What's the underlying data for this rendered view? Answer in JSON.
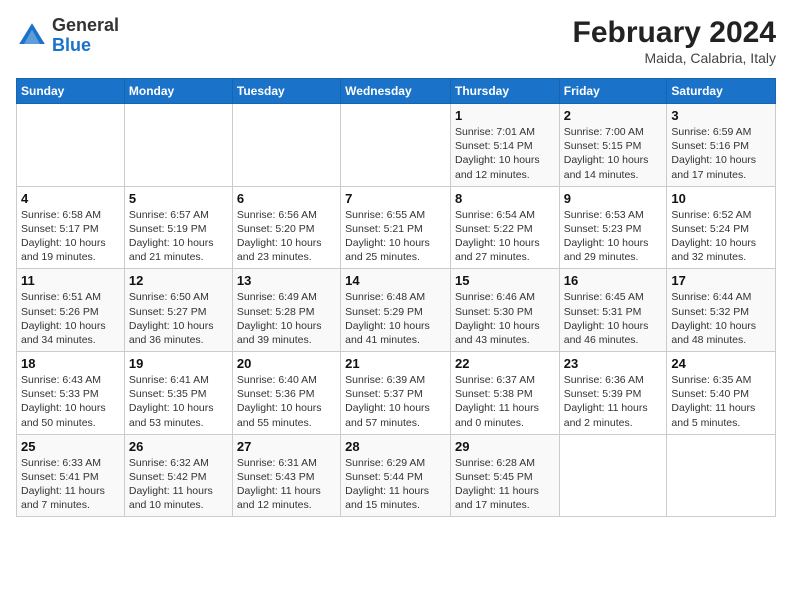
{
  "header": {
    "logo_general": "General",
    "logo_blue": "Blue",
    "title": "February 2024",
    "subtitle": "Maida, Calabria, Italy"
  },
  "days_of_week": [
    "Sunday",
    "Monday",
    "Tuesday",
    "Wednesday",
    "Thursday",
    "Friday",
    "Saturday"
  ],
  "weeks": [
    [
      {
        "num": "",
        "info": ""
      },
      {
        "num": "",
        "info": ""
      },
      {
        "num": "",
        "info": ""
      },
      {
        "num": "",
        "info": ""
      },
      {
        "num": "1",
        "info": "Sunrise: 7:01 AM\nSunset: 5:14 PM\nDaylight: 10 hours\nand 12 minutes."
      },
      {
        "num": "2",
        "info": "Sunrise: 7:00 AM\nSunset: 5:15 PM\nDaylight: 10 hours\nand 14 minutes."
      },
      {
        "num": "3",
        "info": "Sunrise: 6:59 AM\nSunset: 5:16 PM\nDaylight: 10 hours\nand 17 minutes."
      }
    ],
    [
      {
        "num": "4",
        "info": "Sunrise: 6:58 AM\nSunset: 5:17 PM\nDaylight: 10 hours\nand 19 minutes."
      },
      {
        "num": "5",
        "info": "Sunrise: 6:57 AM\nSunset: 5:19 PM\nDaylight: 10 hours\nand 21 minutes."
      },
      {
        "num": "6",
        "info": "Sunrise: 6:56 AM\nSunset: 5:20 PM\nDaylight: 10 hours\nand 23 minutes."
      },
      {
        "num": "7",
        "info": "Sunrise: 6:55 AM\nSunset: 5:21 PM\nDaylight: 10 hours\nand 25 minutes."
      },
      {
        "num": "8",
        "info": "Sunrise: 6:54 AM\nSunset: 5:22 PM\nDaylight: 10 hours\nand 27 minutes."
      },
      {
        "num": "9",
        "info": "Sunrise: 6:53 AM\nSunset: 5:23 PM\nDaylight: 10 hours\nand 29 minutes."
      },
      {
        "num": "10",
        "info": "Sunrise: 6:52 AM\nSunset: 5:24 PM\nDaylight: 10 hours\nand 32 minutes."
      }
    ],
    [
      {
        "num": "11",
        "info": "Sunrise: 6:51 AM\nSunset: 5:26 PM\nDaylight: 10 hours\nand 34 minutes."
      },
      {
        "num": "12",
        "info": "Sunrise: 6:50 AM\nSunset: 5:27 PM\nDaylight: 10 hours\nand 36 minutes."
      },
      {
        "num": "13",
        "info": "Sunrise: 6:49 AM\nSunset: 5:28 PM\nDaylight: 10 hours\nand 39 minutes."
      },
      {
        "num": "14",
        "info": "Sunrise: 6:48 AM\nSunset: 5:29 PM\nDaylight: 10 hours\nand 41 minutes."
      },
      {
        "num": "15",
        "info": "Sunrise: 6:46 AM\nSunset: 5:30 PM\nDaylight: 10 hours\nand 43 minutes."
      },
      {
        "num": "16",
        "info": "Sunrise: 6:45 AM\nSunset: 5:31 PM\nDaylight: 10 hours\nand 46 minutes."
      },
      {
        "num": "17",
        "info": "Sunrise: 6:44 AM\nSunset: 5:32 PM\nDaylight: 10 hours\nand 48 minutes."
      }
    ],
    [
      {
        "num": "18",
        "info": "Sunrise: 6:43 AM\nSunset: 5:33 PM\nDaylight: 10 hours\nand 50 minutes."
      },
      {
        "num": "19",
        "info": "Sunrise: 6:41 AM\nSunset: 5:35 PM\nDaylight: 10 hours\nand 53 minutes."
      },
      {
        "num": "20",
        "info": "Sunrise: 6:40 AM\nSunset: 5:36 PM\nDaylight: 10 hours\nand 55 minutes."
      },
      {
        "num": "21",
        "info": "Sunrise: 6:39 AM\nSunset: 5:37 PM\nDaylight: 10 hours\nand 57 minutes."
      },
      {
        "num": "22",
        "info": "Sunrise: 6:37 AM\nSunset: 5:38 PM\nDaylight: 11 hours\nand 0 minutes."
      },
      {
        "num": "23",
        "info": "Sunrise: 6:36 AM\nSunset: 5:39 PM\nDaylight: 11 hours\nand 2 minutes."
      },
      {
        "num": "24",
        "info": "Sunrise: 6:35 AM\nSunset: 5:40 PM\nDaylight: 11 hours\nand 5 minutes."
      }
    ],
    [
      {
        "num": "25",
        "info": "Sunrise: 6:33 AM\nSunset: 5:41 PM\nDaylight: 11 hours\nand 7 minutes."
      },
      {
        "num": "26",
        "info": "Sunrise: 6:32 AM\nSunset: 5:42 PM\nDaylight: 11 hours\nand 10 minutes."
      },
      {
        "num": "27",
        "info": "Sunrise: 6:31 AM\nSunset: 5:43 PM\nDaylight: 11 hours\nand 12 minutes."
      },
      {
        "num": "28",
        "info": "Sunrise: 6:29 AM\nSunset: 5:44 PM\nDaylight: 11 hours\nand 15 minutes."
      },
      {
        "num": "29",
        "info": "Sunrise: 6:28 AM\nSunset: 5:45 PM\nDaylight: 11 hours\nand 17 minutes."
      },
      {
        "num": "",
        "info": ""
      },
      {
        "num": "",
        "info": ""
      }
    ]
  ]
}
